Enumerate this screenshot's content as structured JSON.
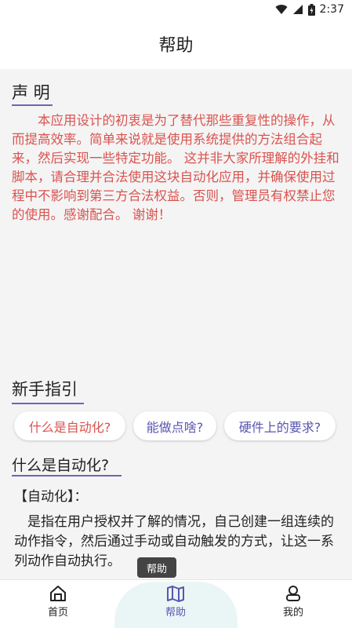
{
  "status_bar": {
    "time": "2:37"
  },
  "app_bar": {
    "title": "帮助"
  },
  "declaration": {
    "title": "声 明",
    "text": "本应用设计的初衷是为了替代那些重复性的操作，从而提高效率。简单来说就是使用系统提供的方法组合起来，然后实现一些特定功能。 这并非大家所理解的外挂和脚本，请合理并合法使用这块自动化应用，并确保使用过程中不影响到第三方合法权益。否则，管理员有权禁止您的使用。感谢配合。 谢谢！"
  },
  "guide": {
    "title": "新手指引",
    "chips": [
      "什么是自动化?",
      "能做点啥?",
      "硬件上的要求?"
    ],
    "selected_question": "什么是自动化?",
    "answer_label": "【自动化】：",
    "answer_text": "是指在用户授权并了解的情况，自己创建一组连续的动作指令，然后通过手动或自动触发的方式，让这一系列动作自动执行。"
  },
  "tooltip": {
    "text": "帮助"
  },
  "bottom_nav": {
    "items": [
      {
        "label": "首页",
        "icon": "home-icon"
      },
      {
        "label": "帮助",
        "icon": "map-icon"
      },
      {
        "label": "我的",
        "icon": "user-icon"
      }
    ],
    "active": "帮助"
  },
  "colors": {
    "accent": "#5a55b0",
    "warning_text": "#d9534f",
    "nav_highlight": "#eaf6f5"
  }
}
